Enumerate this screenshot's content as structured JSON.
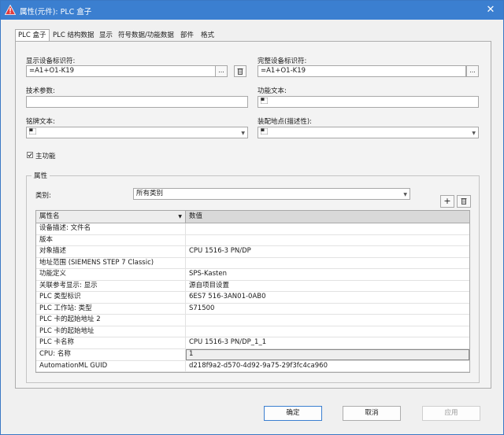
{
  "window": {
    "title": "属性(元件): PLC 盒子",
    "close_glyph": "✕",
    "accent": "#3b7fd0"
  },
  "tabs": [
    {
      "label": "PLC 盒子",
      "active": true
    },
    {
      "label": "PLC 结构数据"
    },
    {
      "label": "显示"
    },
    {
      "label": "符号数据/功能数据"
    },
    {
      "label": "部件"
    },
    {
      "label": "格式"
    }
  ],
  "form": {
    "display_id_label": "显示设备标识符:",
    "display_id_value": "=A1+O1-K19",
    "full_id_label": "完整设备标识符:",
    "full_id_value": "=A1+O1-K19",
    "tech_params_label": "技术参数:",
    "tech_params_value": "",
    "func_text_label": "功能文本:",
    "nameplate_label": "铭牌文本:",
    "mount_label": "装配地点(描述性):",
    "ellipsis": "...",
    "main_function_label": "主功能",
    "main_function_checked": true
  },
  "properties": {
    "group_title": "属性",
    "category_label": "类别:",
    "category_value": "所有类别",
    "col_name": "属性名",
    "col_value": "数值",
    "rows": [
      {
        "name": "设备描述: 文件名",
        "value": ""
      },
      {
        "name": "版本",
        "value": ""
      },
      {
        "name": "对象描述",
        "value": "CPU 1516-3 PN/DP"
      },
      {
        "name": "地址范围 (SIEMENS STEP 7 Classic)",
        "value": ""
      },
      {
        "name": "功能定义",
        "value": "SPS-Kasten"
      },
      {
        "name": "关联参考显示: 显示",
        "value": "源自项目设置"
      },
      {
        "name": "PLC 类型标识",
        "value": "6ES7 516-3AN01-0AB0"
      },
      {
        "name": "PLC 工作站: 类型",
        "value": "S71500"
      },
      {
        "name": "PLC 卡的起始地址 2",
        "value": ""
      },
      {
        "name": "PLC 卡的起始地址",
        "value": ""
      },
      {
        "name": "PLC 卡名称",
        "value": "CPU 1516-3 PN/DP_1_1"
      },
      {
        "name": "CPU: 名称",
        "value": "1"
      },
      {
        "name": "AutomationML GUID",
        "value": "d218f9a2-d570-4d92-9a75-29f3fc4ca960"
      }
    ],
    "add_glyph": "+"
  },
  "buttons": {
    "ok": "确定",
    "cancel": "取消",
    "apply": "应用"
  }
}
